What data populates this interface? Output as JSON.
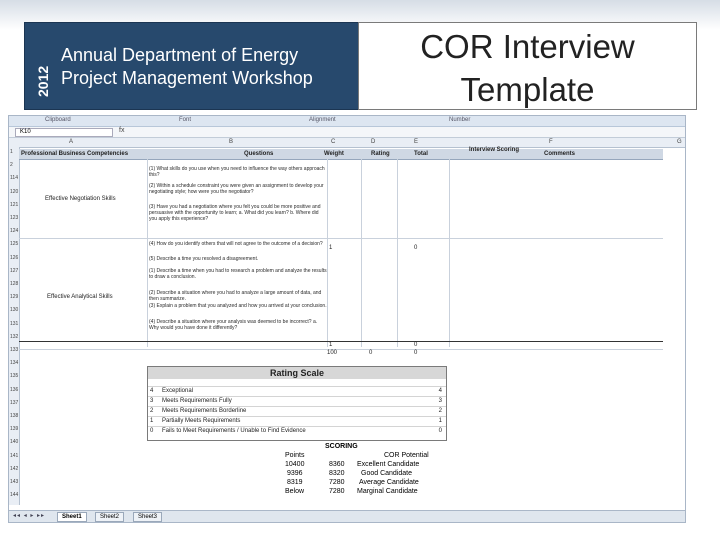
{
  "banner": {
    "year": "2012",
    "line1": "Annual Department of Energy",
    "line2": "Project Management Workshop"
  },
  "title": {
    "line1": "COR Interview",
    "line2": "Template"
  },
  "spreadsheet": {
    "ribbon_groups": [
      "Clipboard",
      "Font",
      "Alignment",
      "Number"
    ],
    "name_box": "K10",
    "formula_icon": "fx",
    "columns": [
      "A",
      "B",
      "C",
      "D",
      "E",
      "F",
      "G"
    ],
    "rows": [
      "1",
      "2",
      "114",
      "120",
      "121",
      "123",
      "124",
      "125",
      "126",
      "127",
      "128",
      "129",
      "130",
      "131",
      "132",
      "133",
      "134",
      "135",
      "136",
      "137",
      "138",
      "139",
      "140",
      "141",
      "142",
      "143",
      "144"
    ],
    "header": {
      "competencies": "Professional Business Competencies",
      "questions": "Questions",
      "weight": "Weight",
      "rating": "Rating",
      "total": "Total",
      "interview_scoring": "Interview Scoring",
      "comments": "Comments"
    },
    "skills": [
      {
        "label": "Effective Negotiation Skills"
      },
      {
        "label": "Effective Analytical Skills"
      }
    ],
    "questions": [
      "(1) What skills do you use when you need to influence the way others approach this?",
      "(2) Within a schedule constraint you were given an assignment to develop your negotiating style; how were you the negotiator?",
      "(3) Have you had a negotiation where you felt you could be more positive and persuasive with the opportunity to learn; a. What did you learn? b. Where did you apply this experience?",
      "(4) How do you identify others that will not agree to the outcome of a decision?",
      "(5) Describe a time you resolved a disagreement.",
      "(1) Describe a time when you had to research a problem and analyze the results to draw a conclusion.",
      "(2) Describe a situation where you had to analyze a large amount of data, and then summarize.",
      "(3) Explain a problem that you analyzed and how you arrived at your conclusion.",
      "(4) Describe a situation where your analysis was deemed to be incorrect? a. Why would you have done it differently?"
    ],
    "weights": [
      "1",
      "1",
      "100"
    ],
    "ratings": [
      "0"
    ],
    "totals": [
      "0",
      "0",
      "0"
    ]
  },
  "rating_scale": {
    "title": "Rating Scale",
    "items": [
      {
        "num": "4",
        "label": "Exceptional",
        "value": "4"
      },
      {
        "num": "3",
        "label": "Meets Requirements Fully",
        "value": "3"
      },
      {
        "num": "2",
        "label": "Meets Requirements Borderline",
        "value": "2"
      },
      {
        "num": "1",
        "label": "Partially Meets Requirements",
        "value": "1"
      },
      {
        "num": "0",
        "label": "Fails to Meet Requirements / Unable to Find Evidence",
        "value": "0"
      }
    ]
  },
  "scoring": {
    "title": "SCORING",
    "col_points": "Points",
    "col_potential": "COR Potential",
    "rows": [
      {
        "points": "10400",
        "score": "8360",
        "label": "Excellent Candidate"
      },
      {
        "points": "9396",
        "score": "8320",
        "label": "Good Candidate"
      },
      {
        "points": "8319",
        "score": "7280",
        "label": "Average Candidate"
      },
      {
        "points": "Below",
        "score": "7280",
        "label": "Marginal Candidate"
      }
    ]
  },
  "sheet_tabs": [
    "Sheet1",
    "Sheet2",
    "Sheet3"
  ]
}
